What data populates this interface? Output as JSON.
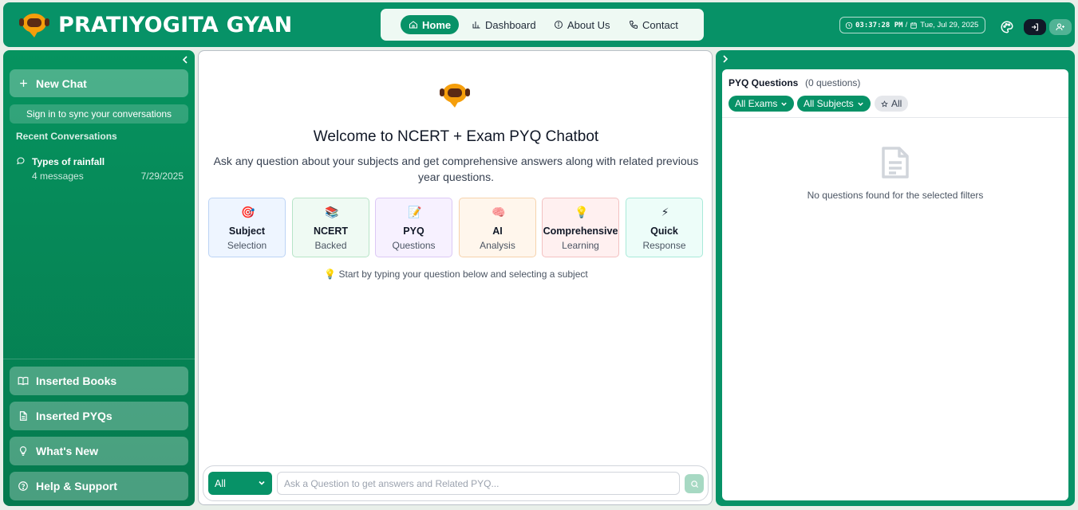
{
  "header": {
    "brand": "PRATIYOGITA GYAN",
    "nav": [
      {
        "label": "Home",
        "icon": "home-icon",
        "active": true
      },
      {
        "label": "Dashboard",
        "icon": "bar-chart-icon",
        "active": false
      },
      {
        "label": "About Us",
        "icon": "info-icon",
        "active": false
      },
      {
        "label": "Contact",
        "icon": "phone-icon",
        "active": false
      }
    ],
    "clock": {
      "time": "03:37:28 PM",
      "separator": "/",
      "date": "Tue, Jul 29, 2025"
    },
    "accent": "#079267"
  },
  "sidebar": {
    "new_chat": "New Chat",
    "sync_note": "Sign in to sync your conversations",
    "recent_title": "Recent Conversations",
    "conversations": [
      {
        "title": "Types of rainfall",
        "count": "4 messages",
        "date": "7/29/2025"
      }
    ],
    "bottom_buttons": [
      {
        "label": "Inserted Books",
        "icon": "book-open-icon"
      },
      {
        "label": "Inserted PYQs",
        "icon": "document-icon"
      },
      {
        "label": "What's New",
        "icon": "lightbulb-icon"
      },
      {
        "label": "Help & Support",
        "icon": "help-circle-icon"
      }
    ]
  },
  "main": {
    "welcome_title": "Welcome to NCERT + Exam PYQ Chatbot",
    "welcome_sub": "Ask any question about your subjects and get comprehensive answers along with related previous year questions.",
    "features": [
      {
        "title": "Subject",
        "sub": "Selection",
        "icon": "target-icon",
        "glyph": "🎯"
      },
      {
        "title": "NCERT",
        "sub": "Backed",
        "icon": "books-icon",
        "glyph": "📚"
      },
      {
        "title": "PYQ",
        "sub": "Questions",
        "icon": "memo-icon",
        "glyph": "📝"
      },
      {
        "title": "AI",
        "sub": "Analysis",
        "icon": "brain-icon",
        "glyph": "🧠"
      },
      {
        "title": "Comprehensive",
        "sub": "Learning",
        "icon": "bulb-icon",
        "glyph": "💡"
      },
      {
        "title": "Quick",
        "sub": "Response",
        "icon": "lightning-icon",
        "glyph": "⚡"
      }
    ],
    "hint": "Start by typing your question below and selecting a subject",
    "hint_glyph": "💡",
    "composer": {
      "subject_value": "All",
      "placeholder": "Ask a Question to get answers and Related PYQ..."
    }
  },
  "pyq_panel": {
    "title": "PYQ Questions",
    "count": "(0 questions)",
    "filters": [
      {
        "label": "All Exams"
      },
      {
        "label": "All Subjects"
      }
    ],
    "star_filter": "All",
    "empty_text": "No questions found for the selected filters"
  }
}
